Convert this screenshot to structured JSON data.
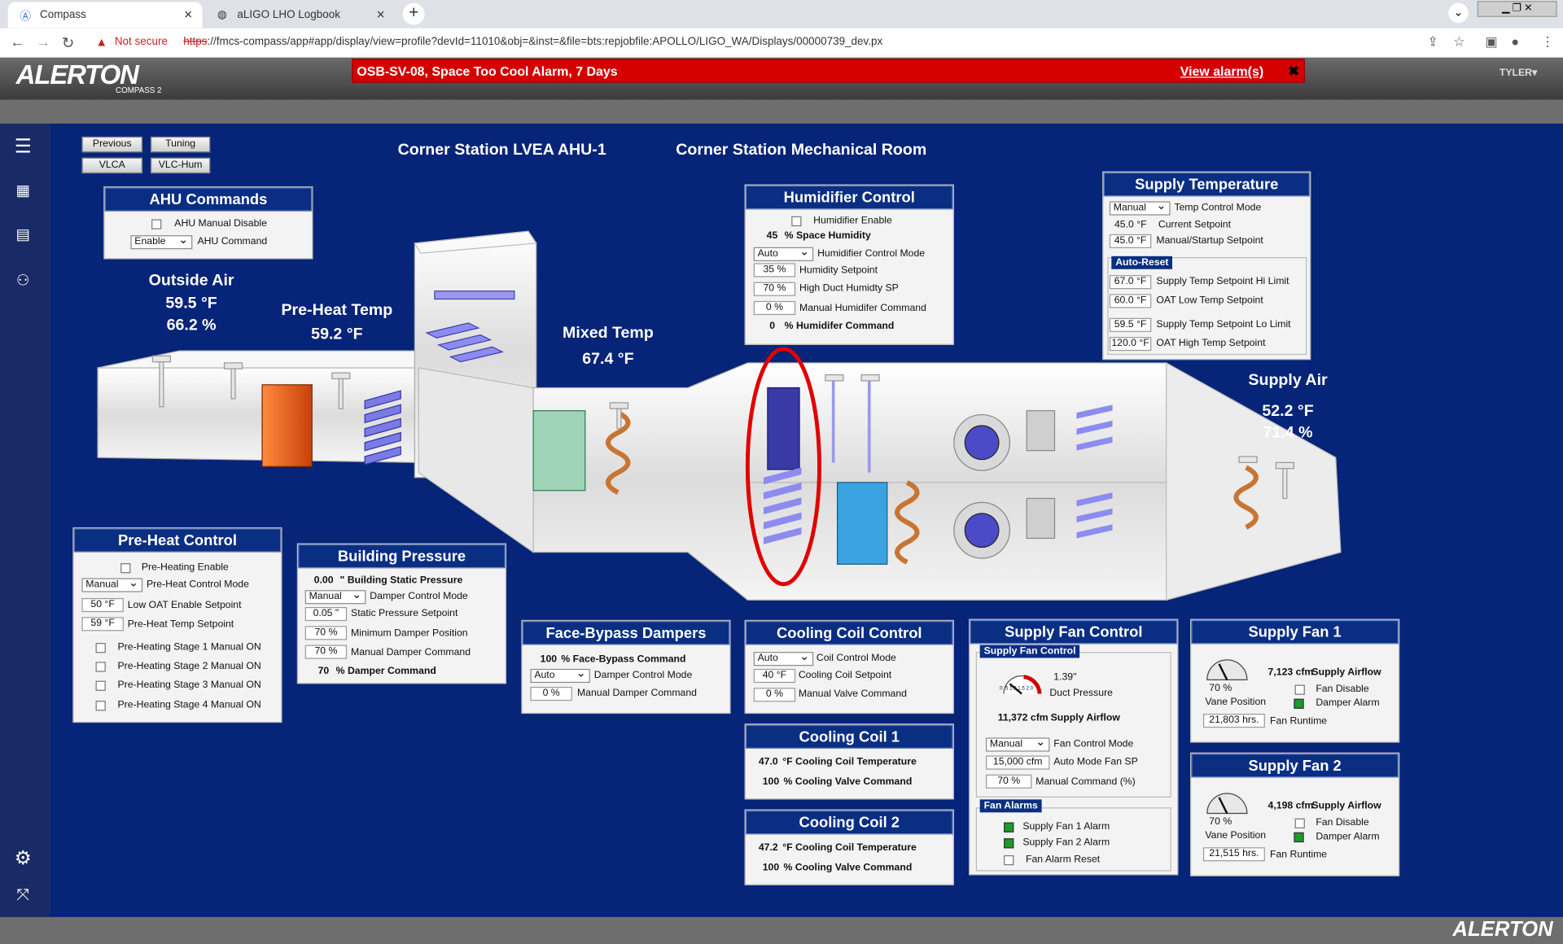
{
  "browser": {
    "tabs": [
      {
        "label": "Compass"
      },
      {
        "label": "aLIGO LHO Logbook"
      }
    ],
    "security": "Not secure",
    "url_scheme": "https",
    "url_rest": "://fmcs-compass/app#app/display/view=profile?devId=11010&obj=&inst=&file=bts:repjobfile:APOLLO/LIGO_WA/Displays/00000739_dev.px"
  },
  "header": {
    "logo": "ALERTON",
    "logo_sub": "COMPASS 2",
    "alarm_text": "OSB-SV-08, Space Too Cool Alarm, 7 Days",
    "alarm_link": "View alarm(s)",
    "user": "TYLER▾"
  },
  "footer": {
    "brand": "ALERTON"
  },
  "nav": {
    "previous": "Previous",
    "tuning": "Tuning",
    "vlca": "VLCA",
    "vlchum": "VLC-Hum"
  },
  "titles": {
    "ahu": "Corner Station LVEA AHU-1",
    "room": "Corner Station Mechanical Room"
  },
  "readings": {
    "outside_air_label": "Outside Air",
    "outside_temp": "59.5 °F",
    "outside_rh": "66.2 %",
    "preheat_label": "Pre-Heat Temp",
    "preheat_temp": "59.2 °F",
    "mixed_label": "Mixed Temp",
    "mixed_temp": "67.4 °F",
    "supply_label": "Supply Air",
    "supply_temp": "52.2 °F",
    "supply_rh": "71.4 %"
  },
  "ahu_commands": {
    "title": "AHU Commands",
    "manual_disable": "AHU Manual Disable",
    "enable_value": "Enable",
    "ahu_command": "AHU Command"
  },
  "preheat": {
    "title": "Pre-Heat Control",
    "enable": "Pre-Heating Enable",
    "mode_value": "Manual",
    "mode_label": "Pre-Heat Control Mode",
    "oat_value": "50 °F",
    "oat_label": "Low OAT Enable Setpoint",
    "sp_value": "59 °F",
    "sp_label": "Pre-Heat Temp Setpoint",
    "stage1": "Pre-Heating Stage 1 Manual ON",
    "stage2": "Pre-Heating Stage 2 Manual ON",
    "stage3": "Pre-Heating Stage 3 Manual ON",
    "stage4": "Pre-Heating Stage 4 Manual ON"
  },
  "building_pressure": {
    "title": "Building Pressure",
    "static_value": "0.00",
    "static_label": "\" Building Static Pressure",
    "mode_value": "Manual",
    "mode_label": "Damper Control Mode",
    "sp_value": "0.05 \"",
    "sp_label": "Static Pressure Setpoint",
    "min_value": "70 %",
    "min_label": "Minimum Damper Position",
    "man_value": "70 %",
    "man_label": "Manual Damper Command",
    "cmd_value": "70",
    "cmd_label": "% Damper Command"
  },
  "face_bypass": {
    "title": "Face-Bypass Dampers",
    "cmd_value": "100",
    "cmd_label": "% Face-Bypass Command",
    "mode_value": "Auto",
    "mode_label": "Damper Control Mode",
    "man_value": "0 %",
    "man_label": "Manual Damper Command"
  },
  "humidifier": {
    "title": "Humidifier Control",
    "enable": "Humidifier Enable",
    "space_value": "45",
    "space_label": "% Space Humidity",
    "mode_value": "Auto",
    "mode_label": "Humidifier Control Mode",
    "sp_value": "35 %",
    "sp_label": "Humidity Setpoint",
    "hi_value": "70 %",
    "hi_label": "High Duct Humidty SP",
    "man_value": "0 %",
    "man_label": "Manual Humidifer Command",
    "cmd_value": "0",
    "cmd_label": "% Humidifer Command"
  },
  "supply_temp": {
    "title": "Supply Temperature",
    "mode_value": "Manual",
    "mode_label": "Temp Control Mode",
    "cur_value": "45.0 °F",
    "cur_label": "Current Setpoint",
    "man_value": "45.0 °F",
    "man_label": "Manual/Startup Setpoint",
    "auto_reset": "Auto-Reset",
    "hi_value": "67.0 °F",
    "hi_label": "Supply Temp Setpoint Hi Limit",
    "oat_low_value": "60.0 °F",
    "oat_low_label": "OAT Low Temp Setpoint",
    "lo_value": "59.5 °F",
    "lo_label": "Supply Temp Setpoint Lo Limit",
    "oat_hi_value": "120.0 °F",
    "oat_hi_label": "OAT High Temp Setpoint"
  },
  "cooling_coil_control": {
    "title": "Cooling Coil Control",
    "mode_value": "Auto",
    "mode_label": "Coil Control Mode",
    "sp_value": "40 °F",
    "sp_label": "Cooling Coil Setpoint",
    "man_value": "0 %",
    "man_label": "Manual Valve Command"
  },
  "cooling_coil_1": {
    "title": "Cooling Coil 1",
    "temp_value": "47.0",
    "temp_label": "°F Cooling Coil Temperature",
    "valve_value": "100",
    "valve_label": "% Cooling Valve Command"
  },
  "cooling_coil_2": {
    "title": "Cooling Coil 2",
    "temp_value": "47.2",
    "temp_label": "°F Cooling Coil Temperature",
    "valve_value": "100",
    "valve_label": "% Cooling Valve Command"
  },
  "supply_fan_control": {
    "title": "Supply Fan Control",
    "sub": "Supply Fan Control",
    "dp_value": "1.39\"",
    "dp_label": "Duct Pressure",
    "gauge_ticks": "0 .5 1.0 1.5 2.0",
    "airflow_value": "11,372 cfm",
    "airflow_label": "Supply Airflow",
    "mode_value": "Manual",
    "mode_label": "Fan Control Mode",
    "sp_value": "15,000 cfm",
    "sp_label": "Auto Mode Fan SP",
    "man_value": "70 %",
    "man_label": "Manual Command (%)",
    "alarms_sub": "Fan Alarms",
    "alarm1": "Supply Fan 1 Alarm",
    "alarm2": "Supply Fan 2 Alarm",
    "reset": "Fan Alarm Reset"
  },
  "supply_fan_1": {
    "title": "Supply Fan 1",
    "vane_value": "70 %",
    "vane_label": "Vane Position",
    "airflow_value": "7,123 cfm",
    "airflow_label": "Supply Airflow",
    "disable": "Fan Disable",
    "damper_alarm": "Damper Alarm",
    "runtime_value": "21,803 hrs.",
    "runtime_label": "Fan Runtime"
  },
  "supply_fan_2": {
    "title": "Supply Fan 2",
    "vane_value": "70 %",
    "vane_label": "Vane Position",
    "airflow_value": "4,198 cfm",
    "airflow_label": "Supply Airflow",
    "disable": "Fan Disable",
    "damper_alarm": "Damper Alarm",
    "runtime_value": "21,515 hrs.",
    "runtime_label": "Fan Runtime"
  },
  "colors": {
    "main_bg": "#062478",
    "panel_header": "#0a2e82",
    "alarm_bg": "#d40000",
    "led_green": "#1d9b2a"
  }
}
